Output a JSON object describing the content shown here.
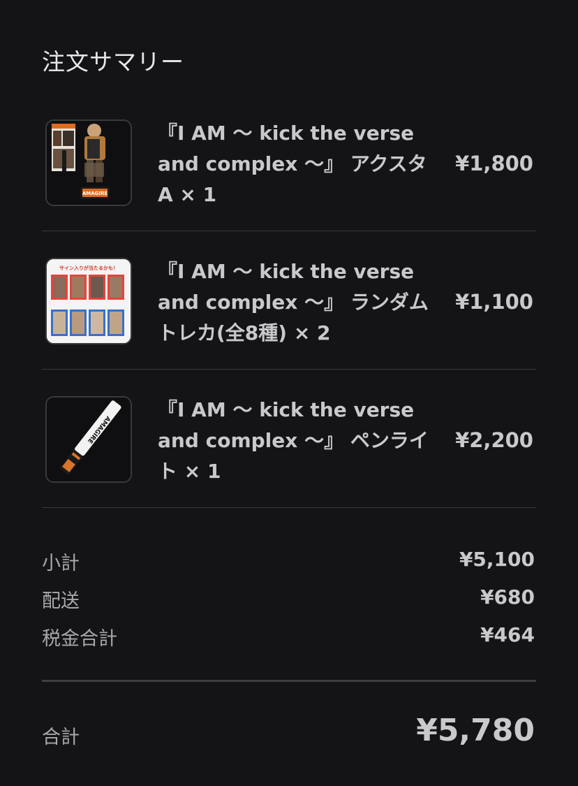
{
  "summary": {
    "title": "注文サマリー",
    "items": [
      {
        "name_line1": "『I AM 〜 kick the verse",
        "name_line2": "and complex 〜』 アクスタ",
        "name_line3": "A × 1",
        "price": "¥1,800",
        "thumb_text": "AMAGIRE"
      },
      {
        "name_line1": "『I AM 〜 kick the verse",
        "name_line2": "and complex 〜』 ランダム",
        "name_line3": "トレカ(全8種) × 2",
        "price": "¥1,100",
        "thumb_text": "サイン入りが当たるかも！"
      },
      {
        "name_line1": "『I AM 〜 kick the verse",
        "name_line2": "and complex 〜』 ペンライ",
        "name_line3": "ト × 1",
        "price": "¥2,200",
        "thumb_text": "AMAGIRE"
      }
    ],
    "subtotal_label": "小計",
    "subtotal_value": "¥5,100",
    "shipping_label": "配送",
    "shipping_value": "¥680",
    "tax_label": "税金合計",
    "tax_value": "¥464",
    "total_label": "合計",
    "total_value": "¥5,780"
  },
  "colors": {
    "background": "#141416",
    "text": "#c9c9cb",
    "divider": "#3a3a3d"
  }
}
